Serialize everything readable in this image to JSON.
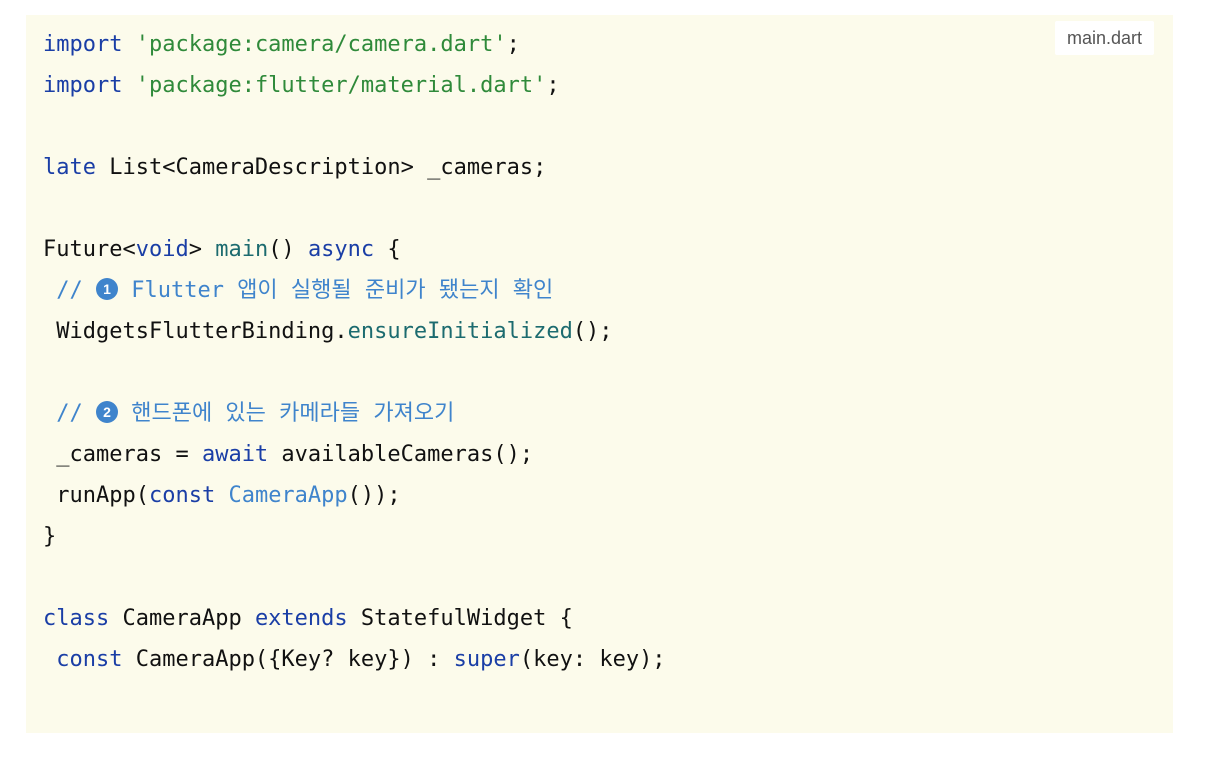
{
  "file_name": "main.dart",
  "code": {
    "l1": {
      "kw": "import",
      "sp": " ",
      "str": "'package:camera/camera.dart'",
      "end": ";"
    },
    "l2": {
      "kw": "import",
      "sp": " ",
      "str": "'package:flutter/material.dart'",
      "end": ";"
    },
    "l4": {
      "kw": "late",
      "rest": " List<CameraDescription> _cameras;"
    },
    "l6": {
      "pre": "Future<",
      "kw1": "void",
      "mid": "> ",
      "fn": "main",
      "mid2": "() ",
      "kw2": "async",
      "end": " {"
    },
    "l7": {
      "prefix": " // ",
      "badge": "1",
      "text": " Flutter 앱이 실행될 준비가 됐는지 확인"
    },
    "l8": {
      "pre": " WidgetsFlutterBinding.",
      "fn": "ensureInitialized",
      "end": "();"
    },
    "l10": {
      "prefix": " // ",
      "badge": "2",
      "text": " 핸드폰에 있는 카메라들 가져오기"
    },
    "l11": {
      "pre": " _cameras = ",
      "kw": "await",
      "end": " availableCameras();"
    },
    "l12": {
      "pre": " runApp(",
      "kw": "const",
      "sp": " ",
      "cls": "CameraApp",
      "end": "());"
    },
    "l13": {
      "text": "}"
    },
    "l15": {
      "kw1": "class",
      "mid": " CameraApp ",
      "kw2": "extends",
      "end": " StatefulWidget {"
    },
    "l16": {
      "pre": " ",
      "kw1": "const",
      "mid": " CameraApp({Key? key}) : ",
      "kw2": "super",
      "end": "(key: key);"
    }
  }
}
